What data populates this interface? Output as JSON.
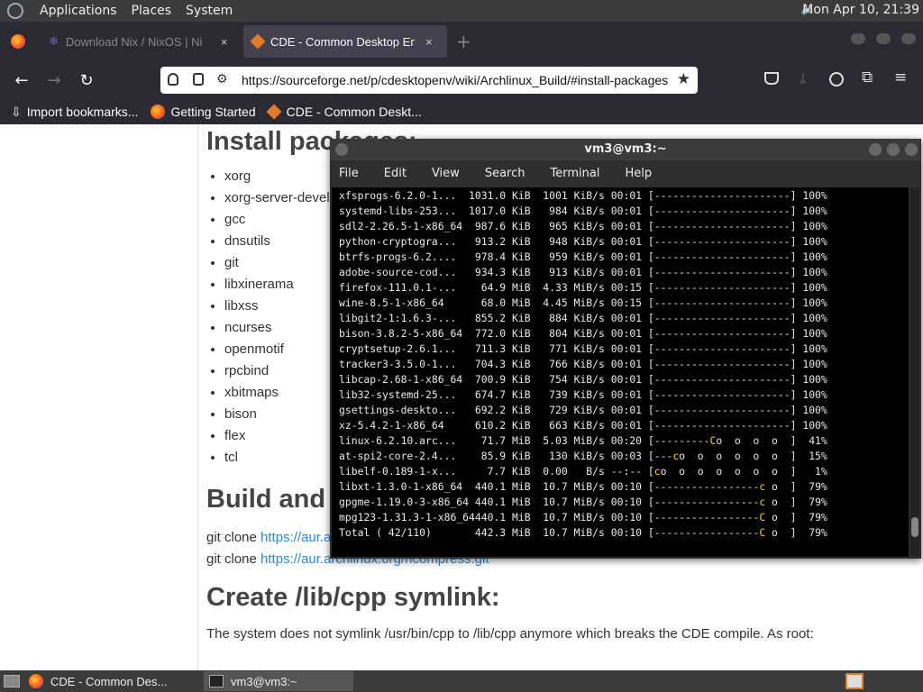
{
  "top_panel": {
    "menus": [
      "Applications",
      "Places",
      "System"
    ],
    "clock": "Mon Apr 10, 21:39"
  },
  "tabs": [
    {
      "title": "Download Nix / NixOS | Ni",
      "close": "×"
    },
    {
      "title": "CDE - Common Desktop Env",
      "close": "×"
    }
  ],
  "new_tab": "+",
  "url": "https://sourceforge.net/p/cdesktopenv/wiki/Archlinux_Build/#install-packages",
  "bookmarks": [
    "Import bookmarks...",
    "Getting Started",
    "CDE - Common Deskt..."
  ],
  "page": {
    "h_install": "Install packages:",
    "packages": [
      "xorg",
      "xorg-server-devel",
      "gcc",
      "dnsutils",
      "git",
      "libxinerama",
      "libxss",
      "ncurses",
      "openmotif",
      "rpcbind",
      "xbitmaps",
      "bison",
      "flex",
      "tcl"
    ],
    "h_build": "Build and install ncompress:",
    "clone1_cmd": "git clone ",
    "clone1_url": "https://aur.archlinux.org/ncompress.git",
    "clone2_cmd": "git clone ",
    "clone2_url": "https://aur.archlinux.org/ncompress.git",
    "h_symlink": "Create /lib/cpp symlink:",
    "para": "The system does not symlink /usr/bin/cpp to /lib/cpp anymore which breaks the CDE compile. As root:"
  },
  "terminal": {
    "title": "vm3@vm3:~",
    "menus": [
      "File",
      "Edit",
      "View",
      "Search",
      "Terminal",
      "Help"
    ],
    "lines": [
      "xfsprogs-6.2.0-1...  1031.0 KiB  1001 KiB/s 00:01 [----------------------] 100%",
      "systemd-libs-253...  1017.0 KiB   984 KiB/s 00:01 [----------------------] 100%",
      "sdl2-2.26.5-1-x86_64  987.6 KiB   965 KiB/s 00:01 [----------------------] 100%",
      "python-cryptogra...   913.2 KiB   948 KiB/s 00:01 [----------------------] 100%",
      "btrfs-progs-6.2....   978.4 KiB   959 KiB/s 00:01 [----------------------] 100%",
      "adobe-source-cod...   934.3 KiB   913 KiB/s 00:01 [----------------------] 100%",
      "firefox-111.0.1-...    64.9 MiB  4.33 MiB/s 00:15 [----------------------] 100%",
      "wine-8.5-1-x86_64      68.0 MiB  4.45 MiB/s 00:15 [----------------------] 100%",
      "libgit2-1:1.6.3-...   855.2 KiB   884 KiB/s 00:01 [----------------------] 100%",
      "bison-3.8.2-5-x86_64  772.0 KiB   804 KiB/s 00:01 [----------------------] 100%",
      "cryptsetup-2.6.1...   711.3 KiB   771 KiB/s 00:01 [----------------------] 100%",
      "tracker3-3.5.0-1...   704.3 KiB   766 KiB/s 00:01 [----------------------] 100%",
      "libcap-2.68-1-x86_64  700.9 KiB   754 KiB/s 00:01 [----------------------] 100%",
      "lib32-systemd-25...   674.7 KiB   739 KiB/s 00:01 [----------------------] 100%",
      "gsettings-deskto...   692.2 KiB   729 KiB/s 00:01 [----------------------] 100%",
      "xz-5.4.2-1-x86_64     610.2 KiB   663 KiB/s 00:01 [----------------------] 100%",
      "linux-6.2.10.arc...    71.7 MiB  5.03 MiB/s 00:20 [---------Co  o  o  o  ]  41%",
      "at-spi2-core-2.4...    85.9 KiB   130 KiB/s 00:03 [---co  o  o  o  o  o  ]  15%",
      "libelf-0.189-1-x...     7.7 KiB  0.00   B/s --:-- [co  o  o  o  o  o  o  ]   1%",
      "libxt-1.3.0-1-x86_64  440.1 MiB  10.7 MiB/s 00:10 [-----------------c o  ]  79%",
      "gpgme-1.19.0-3-x86_64 440.1 MiB  10.7 MiB/s 00:10 [-----------------c o  ]  79%",
      "mpg123-1.31.3-1-x86_64440.1 MiB  10.7 MiB/s 00:10 [-----------------C o  ]  79%",
      "Total ( 42/110)       442.3 MiB  10.7 MiB/s 00:10 [-----------------C o  ]  79%"
    ]
  },
  "taskbar": [
    {
      "label": "CDE - Common Des..."
    },
    {
      "label": "vm3@vm3:~"
    }
  ],
  "colors": {
    "pacman": "#ffd700",
    "link": "#2a8ad6",
    "panel": "#3b3b3b"
  }
}
